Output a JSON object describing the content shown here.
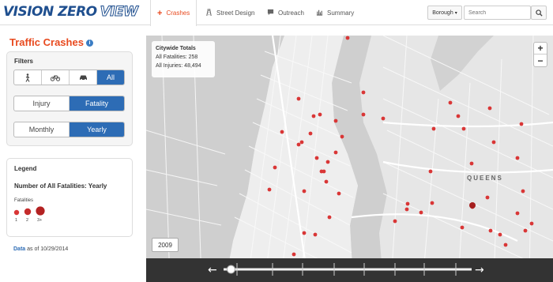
{
  "brand": {
    "part1": "VISION ZERO",
    "part2": "VIEW"
  },
  "nav": {
    "crashes": "Crashes",
    "street_design": "Street Design",
    "outreach": "Outreach",
    "summary": "Summary"
  },
  "search": {
    "borough": "Borough",
    "placeholder": "Search"
  },
  "sidebar": {
    "title": "Traffic Crashes",
    "filters_label": "Filters",
    "mode_all": "All",
    "type": {
      "injury": "Injury",
      "fatality": "Fatality",
      "selected": "Fatality"
    },
    "period": {
      "monthly": "Monthly",
      "yearly": "Yearly",
      "selected": "Yearly"
    },
    "legend": {
      "title": "Legend",
      "subtitle": "Number of All Fatalities: Yearly",
      "fatalities_label": "Fatalities",
      "sizes": [
        "1",
        "2",
        "3+"
      ]
    },
    "footer": {
      "link": "Data",
      "text": "as of 10/29/2014"
    }
  },
  "map": {
    "totals": {
      "title": "Citywide Totals",
      "fatalities": "All Fatalities: 258",
      "injuries": "All Injuries: 48,494"
    },
    "zoom_in": "+",
    "zoom_out": "−",
    "year": "2009",
    "area_label": "QUEENS",
    "timeline": {
      "left_arrow": "←",
      "right_arrow": "→",
      "position": 0.03
    }
  },
  "colors": {
    "accent": "#e84a1f",
    "primary": "#2d6cb5",
    "dot": "#d93636",
    "brand": "#1f4f8f"
  }
}
